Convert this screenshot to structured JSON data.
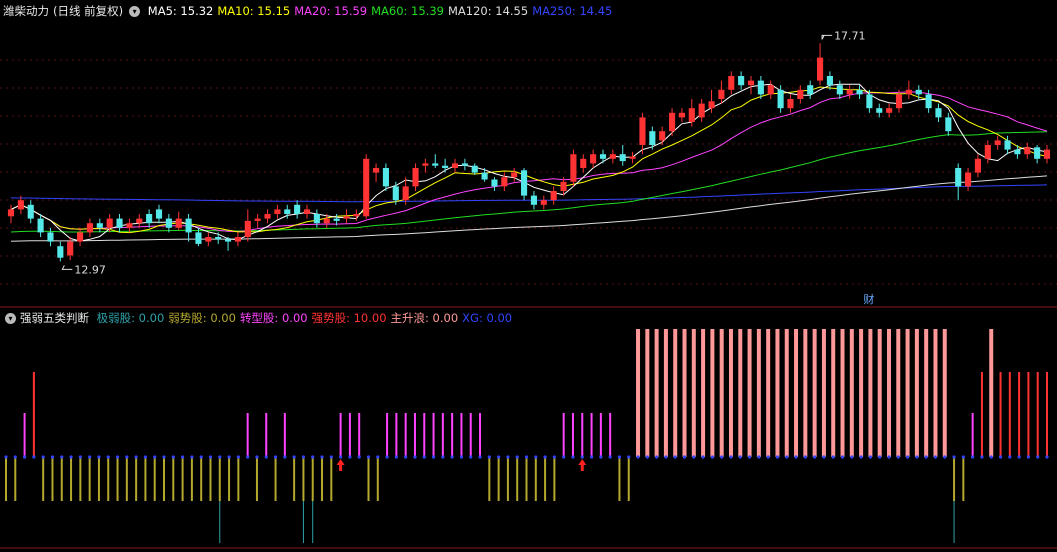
{
  "top_legend": {
    "title": "潍柴动力",
    "mode": "(日线 前复权)",
    "ma": [
      {
        "label": "MA5: 15.32",
        "color": "#ffffff"
      },
      {
        "label": "MA10: 15.15",
        "color": "#ffff00"
      },
      {
        "label": "MA20: 15.59",
        "color": "#ff44ff"
      },
      {
        "label": "MA60: 15.39",
        "color": "#22dd22"
      },
      {
        "label": "MA120: 14.55",
        "color": "#dddddd"
      },
      {
        "label": "MA250: 14.45",
        "color": "#3344ff"
      }
    ]
  },
  "indicator_legend": {
    "title": "强弱五类判断",
    "items": [
      {
        "label": "极弱股: 0.00",
        "color": "#2ea2a8"
      },
      {
        "label": "弱势股: 0.00",
        "color": "#b5a82e"
      },
      {
        "label": "转型股: 0.00",
        "color": "#ff44ff"
      },
      {
        "label": "强势股: 10.00",
        "color": "#ff3333"
      },
      {
        "label": "主升浪: 0.00",
        "color": "#ff9999"
      },
      {
        "label": "XG: 0.00",
        "color": "#3344ff"
      }
    ]
  },
  "annotations": {
    "high_label": "17.71",
    "low_label": "12.97",
    "event_label": "财"
  },
  "colors": {
    "up": "#ff3333",
    "down": "#55e8e8",
    "ma5": "#ffffff",
    "ma10": "#ffff00",
    "ma20": "#ff44ff",
    "ma60": "#22dd22",
    "ma120": "#dddddd",
    "ma250": "#3344ff",
    "weak": "#b5a82e",
    "very_weak": "#2ea2a8",
    "transform": "#ff44ff",
    "strong": "#ff3333",
    "main_rise": "#ff9999",
    "xg": "#3344ff"
  },
  "chart_data": [
    {
      "type": "candlestick",
      "title": "潍柴动力 (日线 前复权)",
      "price_range": [
        12.5,
        18.0
      ],
      "high": 17.71,
      "low": 12.97,
      "candles": [
        {
          "o": 13.95,
          "c": 14.1,
          "h": 14.2,
          "l": 13.8
        },
        {
          "o": 14.1,
          "c": 14.3,
          "h": 14.4,
          "l": 14.0
        },
        {
          "o": 14.2,
          "c": 13.9,
          "h": 14.3,
          "l": 13.8
        },
        {
          "o": 13.9,
          "c": 13.6,
          "h": 14.0,
          "l": 13.5
        },
        {
          "o": 13.6,
          "c": 13.4,
          "h": 13.7,
          "l": 13.3
        },
        {
          "o": 13.3,
          "c": 13.05,
          "h": 13.4,
          "l": 12.97
        },
        {
          "o": 13.1,
          "c": 13.4,
          "h": 13.5,
          "l": 13.0
        },
        {
          "o": 13.4,
          "c": 13.6,
          "h": 13.7,
          "l": 13.3
        },
        {
          "o": 13.6,
          "c": 13.8,
          "h": 13.9,
          "l": 13.5
        },
        {
          "o": 13.8,
          "c": 13.7,
          "h": 13.9,
          "l": 13.6
        },
        {
          "o": 13.7,
          "c": 13.9,
          "h": 14.0,
          "l": 13.6
        },
        {
          "o": 13.9,
          "c": 13.7,
          "h": 14.0,
          "l": 13.6
        },
        {
          "o": 13.7,
          "c": 13.8,
          "h": 13.9,
          "l": 13.6
        },
        {
          "o": 13.8,
          "c": 13.9,
          "h": 14.0,
          "l": 13.7
        },
        {
          "o": 14.0,
          "c": 13.8,
          "h": 14.1,
          "l": 13.7
        },
        {
          "o": 14.1,
          "c": 13.9,
          "h": 14.2,
          "l": 13.8
        },
        {
          "o": 13.9,
          "c": 13.7,
          "h": 14.0,
          "l": 13.6
        },
        {
          "o": 13.7,
          "c": 13.9,
          "h": 14.05,
          "l": 13.65
        },
        {
          "o": 13.9,
          "c": 13.6,
          "h": 14.0,
          "l": 13.4
        },
        {
          "o": 13.6,
          "c": 13.35,
          "h": 13.7,
          "l": 13.3
        },
        {
          "o": 13.4,
          "c": 13.5,
          "h": 13.6,
          "l": 13.3
        },
        {
          "o": 13.5,
          "c": 13.45,
          "h": 13.6,
          "l": 13.35
        },
        {
          "o": 13.45,
          "c": 13.4,
          "h": 13.5,
          "l": 13.2
        },
        {
          "o": 13.4,
          "c": 13.5,
          "h": 13.6,
          "l": 13.3
        },
        {
          "o": 13.5,
          "c": 13.85,
          "h": 14.1,
          "l": 13.4
        },
        {
          "o": 13.85,
          "c": 13.9,
          "h": 14.0,
          "l": 13.7
        },
        {
          "o": 13.9,
          "c": 14.0,
          "h": 14.1,
          "l": 13.8
        },
        {
          "o": 14.0,
          "c": 14.1,
          "h": 14.2,
          "l": 13.9
        },
        {
          "o": 14.1,
          "c": 14.0,
          "h": 14.2,
          "l": 13.9
        },
        {
          "o": 14.2,
          "c": 14.0,
          "h": 14.3,
          "l": 13.9
        },
        {
          "o": 14.0,
          "c": 14.1,
          "h": 14.2,
          "l": 13.9
        },
        {
          "o": 14.0,
          "c": 13.8,
          "h": 14.1,
          "l": 13.7
        },
        {
          "o": 13.8,
          "c": 13.9,
          "h": 14.0,
          "l": 13.7
        },
        {
          "o": 13.9,
          "c": 13.85,
          "h": 14.0,
          "l": 13.75
        },
        {
          "o": 13.9,
          "c": 13.95,
          "h": 14.1,
          "l": 13.8
        },
        {
          "o": 13.95,
          "c": 14.0,
          "h": 14.1,
          "l": 13.85
        },
        {
          "o": 13.95,
          "c": 15.2,
          "h": 15.3,
          "l": 13.9
        },
        {
          "o": 14.9,
          "c": 15.0,
          "h": 15.1,
          "l": 14.7
        },
        {
          "o": 15.0,
          "c": 14.6,
          "h": 15.1,
          "l": 14.5
        },
        {
          "o": 14.6,
          "c": 14.3,
          "h": 14.7,
          "l": 14.2
        },
        {
          "o": 14.3,
          "c": 14.6,
          "h": 14.8,
          "l": 14.2
        },
        {
          "o": 14.6,
          "c": 15.0,
          "h": 15.1,
          "l": 14.5
        },
        {
          "o": 15.05,
          "c": 15.1,
          "h": 15.2,
          "l": 14.9
        },
        {
          "o": 15.1,
          "c": 15.05,
          "h": 15.3,
          "l": 15.0
        },
        {
          "o": 15.05,
          "c": 15.0,
          "h": 15.2,
          "l": 14.9
        },
        {
          "o": 15.0,
          "c": 15.1,
          "h": 15.2,
          "l": 14.9
        },
        {
          "o": 15.1,
          "c": 15.05,
          "h": 15.2,
          "l": 14.95
        },
        {
          "o": 15.05,
          "c": 14.9,
          "h": 15.1,
          "l": 14.85
        },
        {
          "o": 14.9,
          "c": 14.75,
          "h": 15.0,
          "l": 14.7
        },
        {
          "o": 14.75,
          "c": 14.6,
          "h": 14.8,
          "l": 14.5
        },
        {
          "o": 14.6,
          "c": 14.8,
          "h": 14.9,
          "l": 14.5
        },
        {
          "o": 14.8,
          "c": 14.9,
          "h": 15.0,
          "l": 14.7
        },
        {
          "o": 14.95,
          "c": 14.4,
          "h": 15.0,
          "l": 14.3
        },
        {
          "o": 14.4,
          "c": 14.2,
          "h": 14.5,
          "l": 14.1
        },
        {
          "o": 14.2,
          "c": 14.3,
          "h": 14.4,
          "l": 14.1
        },
        {
          "o": 14.3,
          "c": 14.5,
          "h": 14.6,
          "l": 14.2
        },
        {
          "o": 14.5,
          "c": 14.7,
          "h": 14.8,
          "l": 14.4
        },
        {
          "o": 14.7,
          "c": 15.3,
          "h": 15.4,
          "l": 14.6
        },
        {
          "o": 15.0,
          "c": 15.2,
          "h": 15.3,
          "l": 14.9
        },
        {
          "o": 15.1,
          "c": 15.3,
          "h": 15.4,
          "l": 15.0
        },
        {
          "o": 15.3,
          "c": 15.2,
          "h": 15.4,
          "l": 15.1
        },
        {
          "o": 15.2,
          "c": 15.3,
          "h": 15.4,
          "l": 15.1
        },
        {
          "o": 15.3,
          "c": 15.15,
          "h": 15.5,
          "l": 15.05
        },
        {
          "o": 15.2,
          "c": 15.25,
          "h": 15.35,
          "l": 15.1
        },
        {
          "o": 15.5,
          "c": 16.1,
          "h": 16.2,
          "l": 15.3
        },
        {
          "o": 15.8,
          "c": 15.5,
          "h": 15.9,
          "l": 15.4
        },
        {
          "o": 15.6,
          "c": 15.8,
          "h": 15.9,
          "l": 15.5
        },
        {
          "o": 15.8,
          "c": 16.2,
          "h": 16.3,
          "l": 15.7
        },
        {
          "o": 16.1,
          "c": 16.2,
          "h": 16.3,
          "l": 16.0
        },
        {
          "o": 16.0,
          "c": 16.3,
          "h": 16.5,
          "l": 15.9
        },
        {
          "o": 16.1,
          "c": 16.4,
          "h": 16.5,
          "l": 16.0
        },
        {
          "o": 16.3,
          "c": 16.45,
          "h": 16.7,
          "l": 16.2
        },
        {
          "o": 16.5,
          "c": 16.7,
          "h": 16.9,
          "l": 16.4
        },
        {
          "o": 16.7,
          "c": 17.0,
          "h": 17.1,
          "l": 16.6
        },
        {
          "o": 17.0,
          "c": 16.8,
          "h": 17.1,
          "l": 16.7
        },
        {
          "o": 16.8,
          "c": 16.9,
          "h": 17.0,
          "l": 16.6
        },
        {
          "o": 16.9,
          "c": 16.6,
          "h": 17.0,
          "l": 16.5
        },
        {
          "o": 16.6,
          "c": 16.8,
          "h": 16.9,
          "l": 16.5
        },
        {
          "o": 16.7,
          "c": 16.3,
          "h": 16.8,
          "l": 16.2
        },
        {
          "o": 16.3,
          "c": 16.5,
          "h": 16.6,
          "l": 16.2
        },
        {
          "o": 16.5,
          "c": 16.7,
          "h": 16.8,
          "l": 16.4
        },
        {
          "o": 16.8,
          "c": 16.6,
          "h": 16.9,
          "l": 16.5
        },
        {
          "o": 16.9,
          "c": 17.4,
          "h": 17.71,
          "l": 16.8
        },
        {
          "o": 17.0,
          "c": 16.8,
          "h": 17.1,
          "l": 16.7
        },
        {
          "o": 16.8,
          "c": 16.6,
          "h": 16.9,
          "l": 16.5
        },
        {
          "o": 16.6,
          "c": 16.7,
          "h": 16.8,
          "l": 16.5
        },
        {
          "o": 16.7,
          "c": 16.6,
          "h": 16.8,
          "l": 16.5
        },
        {
          "o": 16.6,
          "c": 16.3,
          "h": 16.7,
          "l": 16.2
        },
        {
          "o": 16.3,
          "c": 16.2,
          "h": 16.4,
          "l": 16.1
        },
        {
          "o": 16.2,
          "c": 16.3,
          "h": 16.4,
          "l": 16.1
        },
        {
          "o": 16.3,
          "c": 16.6,
          "h": 16.7,
          "l": 16.2
        },
        {
          "o": 16.6,
          "c": 16.7,
          "h": 16.9,
          "l": 16.5
        },
        {
          "o": 16.7,
          "c": 16.6,
          "h": 16.8,
          "l": 16.5
        },
        {
          "o": 16.6,
          "c": 16.3,
          "h": 16.7,
          "l": 16.2
        },
        {
          "o": 16.3,
          "c": 16.1,
          "h": 16.4,
          "l": 16.0
        },
        {
          "o": 16.1,
          "c": 15.8,
          "h": 16.2,
          "l": 15.7
        },
        {
          "o": 15.0,
          "c": 14.6,
          "h": 15.1,
          "l": 14.3
        },
        {
          "o": 14.6,
          "c": 14.9,
          "h": 15.0,
          "l": 14.5
        },
        {
          "o": 14.9,
          "c": 15.2,
          "h": 15.3,
          "l": 14.8
        },
        {
          "o": 15.2,
          "c": 15.5,
          "h": 15.6,
          "l": 15.1
        },
        {
          "o": 15.5,
          "c": 15.6,
          "h": 15.7,
          "l": 15.4
        },
        {
          "o": 15.6,
          "c": 15.4,
          "h": 15.7,
          "l": 15.3
        },
        {
          "o": 15.4,
          "c": 15.3,
          "h": 15.5,
          "l": 15.2
        },
        {
          "o": 15.3,
          "c": 15.45,
          "h": 15.55,
          "l": 15.2
        },
        {
          "o": 15.45,
          "c": 15.2,
          "h": 15.5,
          "l": 15.1
        },
        {
          "o": 15.2,
          "c": 15.4,
          "h": 15.5,
          "l": 15.1
        }
      ],
      "ma_latest": {
        "MA5": 15.32,
        "MA10": 15.15,
        "MA20": 15.59,
        "MA60": 15.39,
        "MA120": 14.55,
        "MA250": 14.45
      }
    },
    {
      "type": "bar",
      "title": "强弱五类判断",
      "values_latest": {
        "极弱股": 0.0,
        "弱势股": 0.0,
        "转型股": 0.0,
        "强势股": 10.0,
        "主升浪": 0.0,
        "XG": 0.0
      },
      "classes": [
        "W",
        "W",
        "T",
        "S",
        "W",
        "W",
        "W",
        "W",
        "W",
        "W",
        "W",
        "W",
        "W",
        "W",
        "W",
        "W",
        "W",
        "W",
        "W",
        "W",
        "W",
        "W",
        "W",
        "V",
        "W",
        "W",
        "T",
        "W",
        "T",
        "W",
        "T",
        "W",
        "V",
        "V",
        "W",
        "W",
        "T",
        "T",
        "T",
        "W",
        "W",
        "T",
        "T",
        "T",
        "T",
        "T",
        "T",
        "T",
        "T",
        "T",
        "T",
        "T",
        "W",
        "W",
        "W",
        "W",
        "W",
        "W",
        "W",
        "W",
        "T",
        "T",
        "T",
        "T",
        "T",
        "T",
        "W",
        "W",
        "M",
        "M",
        "M",
        "M",
        "M",
        "M",
        "M",
        "M",
        "M",
        "M",
        "M",
        "M",
        "M",
        "M",
        "M",
        "M",
        "M",
        "M",
        "M",
        "M",
        "M",
        "M",
        "M",
        "M",
        "M",
        "M",
        "M",
        "M",
        "M",
        "M",
        "M",
        "M",
        "M",
        "M",
        "V",
        "W",
        "T",
        "S",
        "M",
        "S",
        "S",
        "S",
        "S",
        "S",
        "S"
      ],
      "signals": [
        36,
        62
      ]
    }
  ]
}
